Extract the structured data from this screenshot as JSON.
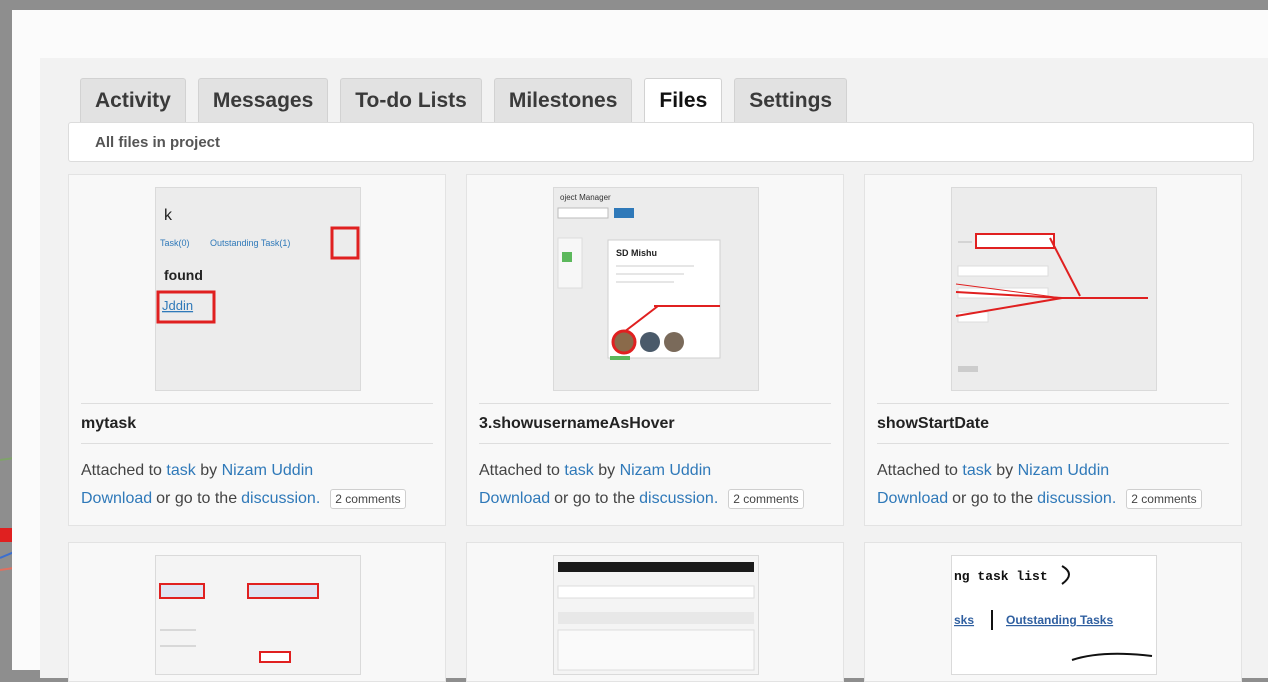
{
  "tabs": [
    {
      "label": "Activity",
      "active": false
    },
    {
      "label": "Messages",
      "active": false
    },
    {
      "label": "To-do Lists",
      "active": false
    },
    {
      "label": "Milestones",
      "active": false
    },
    {
      "label": "Files",
      "active": true
    },
    {
      "label": "Settings",
      "active": false
    }
  ],
  "filter": {
    "label": "All files in project"
  },
  "common": {
    "attached_prefix": "Attached to",
    "by": "by",
    "download": "Download",
    "or_go": "or go to the",
    "discussion": "discussion."
  },
  "files": [
    {
      "name": "mytask",
      "attached_to": "task",
      "author": "Nizam Uddin",
      "comments": "2 comments",
      "thumb_text": {
        "t1": "k",
        "t2": "Task(0)",
        "t3": "Outstanding Task(1)",
        "t4": "found",
        "t5": "Jddin"
      }
    },
    {
      "name": "3.showusernameAsHover",
      "attached_to": "task",
      "author": "Nizam Uddin",
      "comments": "2 comments",
      "thumb_text": {
        "t1": "oject Manager",
        "t2": "SD Mishu"
      }
    },
    {
      "name": "showStartDate",
      "attached_to": "task",
      "author": "Nizam Uddin",
      "comments": "2 comments",
      "thumb_text": {}
    }
  ],
  "partial_thumbs": {
    "third": {
      "t1": "ng task list",
      "t2": "sks",
      "t3": "Outstanding Tasks"
    }
  },
  "colors": {
    "link": "#2f79b9",
    "accent_red": "#e02020"
  }
}
